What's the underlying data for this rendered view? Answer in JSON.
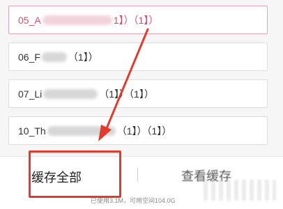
{
  "list": {
    "items": [
      {
        "prefix": "05_A",
        "tail": "1】）（1】）",
        "selected": true
      },
      {
        "prefix": "06_F",
        "tail": "（1】）",
        "selected": false
      },
      {
        "prefix": "07_Li",
        "tail": "（1】）（1】）",
        "selected": false
      },
      {
        "prefix": "10_Th",
        "tail": "（1】）（1】）",
        "selected": false
      }
    ]
  },
  "bottom_bar": {
    "cache_all_label": "缓存全部",
    "view_cache_label": "查看缓存",
    "storage_info": "已使用3.1M，可用空间104.0G"
  },
  "colors": {
    "highlight_box": "#e23b2e",
    "arrow": "#e23b2e",
    "selected_border": "#e9a3b6",
    "selected_text": "#c9536f"
  }
}
